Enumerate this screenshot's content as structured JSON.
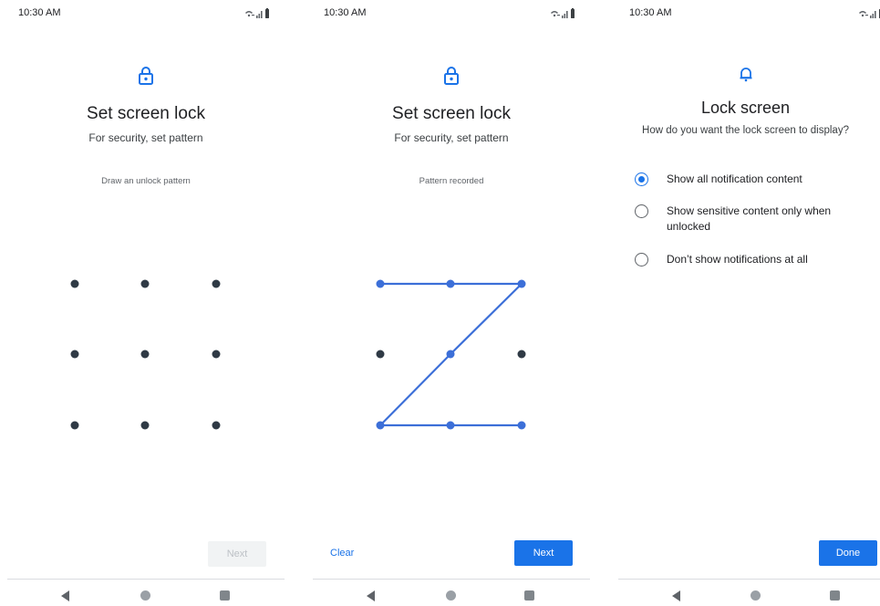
{
  "status_bar": {
    "time": "10:30 AM",
    "icons": [
      "wifi-calling-icon",
      "signal-icon",
      "battery-icon"
    ]
  },
  "screen1": {
    "title": "Set screen lock",
    "subtitle": "For security, set pattern",
    "hint": "Draw an unlock pattern",
    "next_label": "Next",
    "next_enabled": false
  },
  "screen2": {
    "title": "Set screen lock",
    "subtitle": "For security, set pattern",
    "hint": "Pattern recorded",
    "clear_label": "Clear",
    "next_label": "Next",
    "pattern": [
      1,
      2,
      3,
      5,
      7,
      8,
      9
    ]
  },
  "screen3": {
    "title": "Lock screen",
    "subtitle": "How do you want the lock screen to display?",
    "options": [
      {
        "label": "Show all notification content",
        "checked": true
      },
      {
        "label": "Show sensitive content only when unlocked",
        "checked": false
      },
      {
        "label": "Don’t show notifications at all",
        "checked": false
      }
    ],
    "done_label": "Done"
  },
  "colors": {
    "accent": "#1a73e8",
    "pattern_line": "#3c6fd8",
    "dot": "#2f3a45"
  }
}
